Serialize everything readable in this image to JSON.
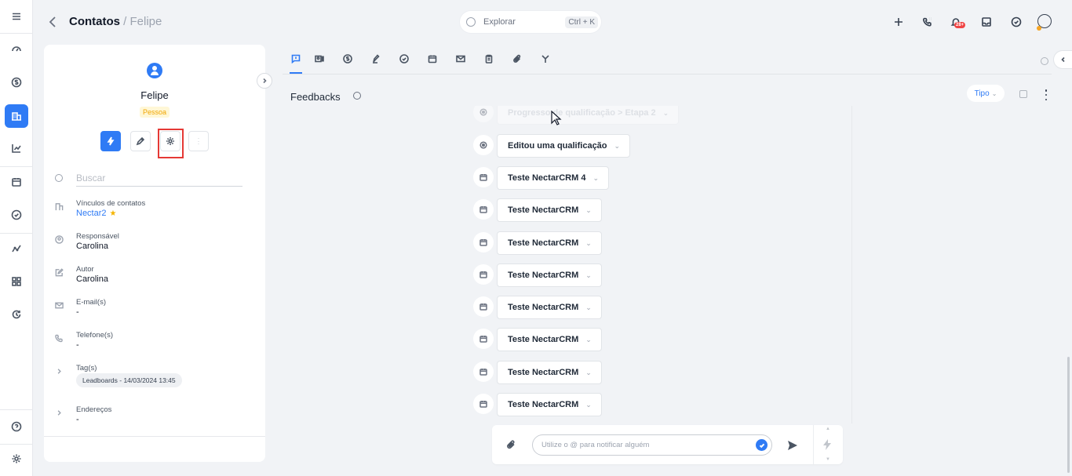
{
  "header": {
    "breadcrumb_main": "Contatos",
    "breadcrumb_sep": " / ",
    "breadcrumb_sub": "Felipe",
    "explore_placeholder": "Explorar",
    "explore_shortcut": "Ctrl + K",
    "notification_count": "28+"
  },
  "contact": {
    "name": "Felipe",
    "type": "Pessoa",
    "search_placeholder": "Buscar",
    "fields": {
      "links_label": "Vínculos de contatos",
      "links_value": "Nectar2",
      "owner_label": "Responsável",
      "owner_value": "Carolina",
      "author_label": "Autor",
      "author_value": "Carolina",
      "email_label": "E-mail(s)",
      "email_value": "-",
      "phone_label": "Telefone(s)",
      "phone_value": "-",
      "tags_label": "Tag(s)",
      "tag_value": "Leadboards - 14/03/2024 13:45",
      "address_label": "Endereços",
      "address_value": "-"
    }
  },
  "feed": {
    "title": "Feedbacks",
    "type_filter": "Tipo",
    "items": [
      {
        "label": "Progresso de qualificação > Etapa 2",
        "icon": "target-icon"
      },
      {
        "label": "Editou uma qualificação",
        "icon": "target-icon"
      },
      {
        "label": "Teste NectarCRM 4",
        "icon": "calendar-icon"
      },
      {
        "label": "Teste NectarCRM",
        "icon": "calendar-icon"
      },
      {
        "label": "Teste NectarCRM",
        "icon": "calendar-icon"
      },
      {
        "label": "Teste NectarCRM",
        "icon": "calendar-icon"
      },
      {
        "label": "Teste NectarCRM",
        "icon": "calendar-icon"
      },
      {
        "label": "Teste NectarCRM",
        "icon": "calendar-icon"
      },
      {
        "label": "Teste NectarCRM",
        "icon": "calendar-icon"
      },
      {
        "label": "Teste NectarCRM",
        "icon": "calendar-icon"
      }
    ]
  },
  "composer": {
    "placeholder": "Utilize o @ para notificar alguém"
  },
  "colors": {
    "accent": "#2f7bf5",
    "highlight": "#e53935",
    "tag_yellow": "#f0a500"
  }
}
